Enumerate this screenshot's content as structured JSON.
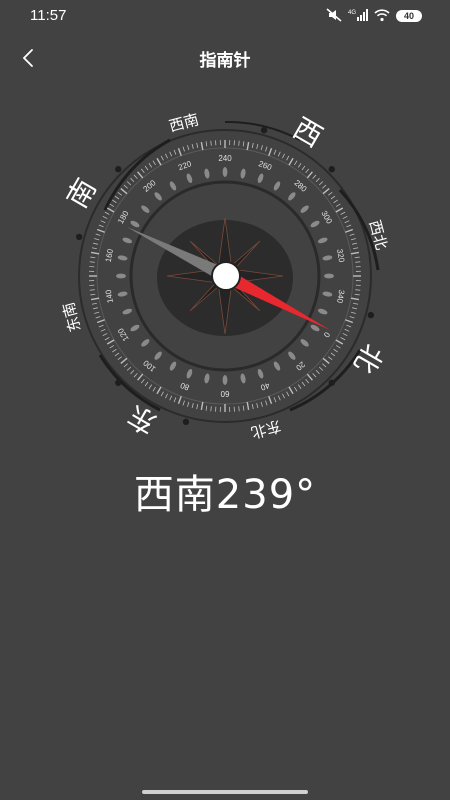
{
  "status_bar": {
    "time": "11:57",
    "battery": "40"
  },
  "header": {
    "title": "指南针"
  },
  "compass": {
    "heading_degrees": 239,
    "readout": "西南239°",
    "major_directions": [
      "北",
      "东",
      "南",
      "西"
    ],
    "minor_directions": [
      "东北",
      "东南",
      "西南",
      "西北"
    ],
    "degree_labels": [
      "0",
      "20",
      "40",
      "60",
      "80",
      "100",
      "120",
      "140",
      "160",
      "180",
      "200",
      "220",
      "240",
      "260",
      "280",
      "300",
      "320",
      "340"
    ],
    "needle_colors": {
      "north": "#e8282f",
      "south": "#7a7a7a"
    }
  }
}
